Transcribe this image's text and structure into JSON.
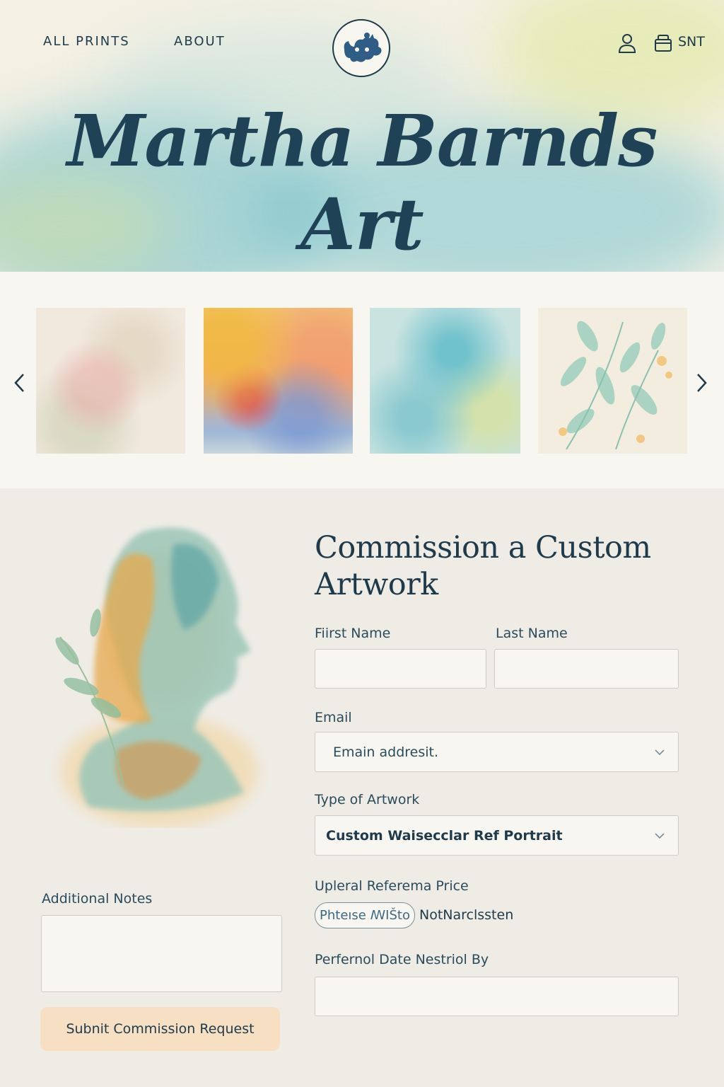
{
  "nav": {
    "all_prints": "ALL PRINTS",
    "about": "ABOUT",
    "cart_label": "SNT",
    "icons": [
      "logo-emblem-icon",
      "user-icon",
      "cart-icon"
    ]
  },
  "hero": {
    "title": "Martha Barnds Art"
  },
  "gallery": {
    "prev_icon": "chevron-left-icon",
    "next_icon": "chevron-right-icon",
    "items": [
      {
        "style": "soft pastel floral"
      },
      {
        "style": "warm sunset abstract"
      },
      {
        "style": "teal and yellow wash"
      },
      {
        "style": "botanical leaves"
      }
    ]
  },
  "commission": {
    "heading": "Commission a Custom Artwork",
    "first_name_label": "Fiirst Name",
    "first_name_value": "",
    "last_name_label": "Last Name",
    "last_name_value": "",
    "email_label": "Email",
    "email_placeholder": "Emain addresit.",
    "artwork_type_label": "Type of Artwork",
    "artwork_type_value": "Custom Waisecclar Ref Portrait",
    "reference_label": "Upleral Referema Price",
    "reference_button": "Phteıse ꟿIŠto",
    "reference_note": "NotNarclssten",
    "date_label": "Perfernol Date Nestriol By",
    "date_value": "",
    "notes_label": "Additional Notes",
    "notes_value": "",
    "submit_label": "Subnit Commission Request"
  },
  "colors": {
    "ink": "#1f3a4a",
    "teal_wash": "#7ec3cb",
    "button_peach": "#f6dfc3",
    "field_bg": "#f8f6f1",
    "section_bg": "#efece6"
  }
}
